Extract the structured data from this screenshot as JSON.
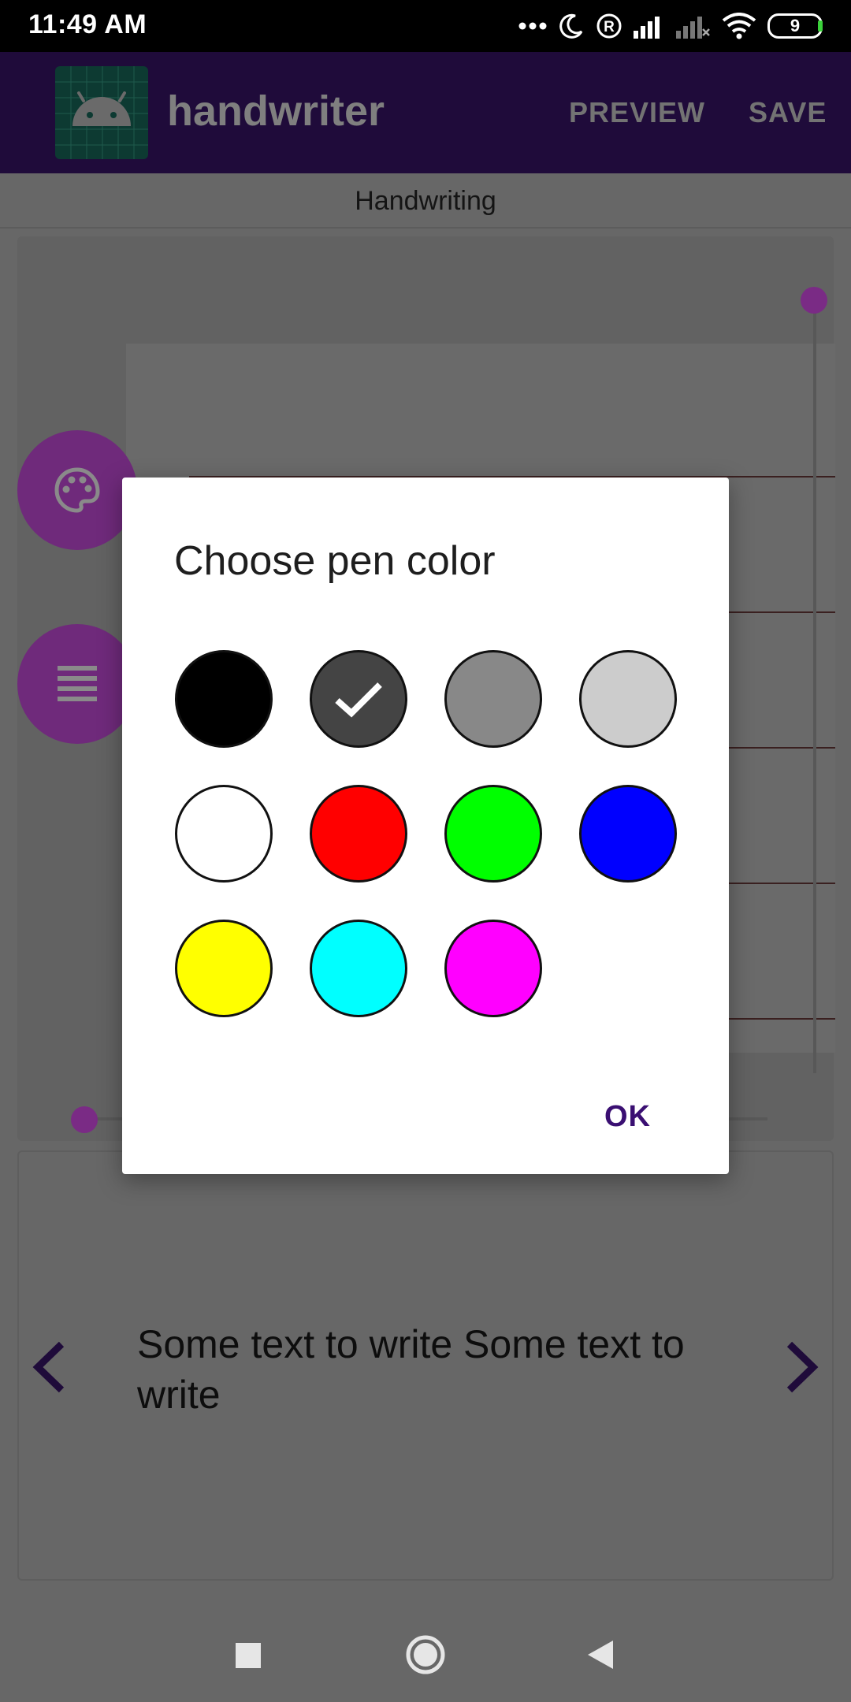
{
  "status_bar": {
    "time": "11:49 AM",
    "battery_level": "9",
    "icons": [
      "more-dots-icon",
      "moon-icon",
      "registered-icon",
      "signal-icon",
      "signal-off-icon",
      "wifi-icon",
      "battery-icon"
    ]
  },
  "app_bar": {
    "title": "handwriter",
    "preview_label": "PREVIEW",
    "save_label": "SAVE",
    "background": "#1f0b3a"
  },
  "tab": {
    "label": "Handwriting"
  },
  "canvas": {
    "fab_palette_icon": "palette-icon",
    "fab_lines_icon": "lines-icon",
    "slider_accent": "#7a2b85"
  },
  "text_panel": {
    "sample_text": "Some text to write Some text to write",
    "prev_icon": "chevron-left-icon",
    "next_icon": "chevron-right-icon"
  },
  "dialog": {
    "title": "Choose pen color",
    "ok_label": "OK",
    "selected_index": 1,
    "colors": [
      {
        "name": "black",
        "hex": "#000000"
      },
      {
        "name": "dark-gray",
        "hex": "#444444"
      },
      {
        "name": "gray",
        "hex": "#888888"
      },
      {
        "name": "light-gray",
        "hex": "#cccccc"
      },
      {
        "name": "white",
        "hex": "#ffffff"
      },
      {
        "name": "red",
        "hex": "#ff0000"
      },
      {
        "name": "green",
        "hex": "#00ff00"
      },
      {
        "name": "blue",
        "hex": "#0000ff"
      },
      {
        "name": "yellow",
        "hex": "#ffff00"
      },
      {
        "name": "cyan",
        "hex": "#00ffff"
      },
      {
        "name": "magenta",
        "hex": "#ff00ff"
      }
    ]
  },
  "nav_bar": {
    "icons": [
      "recents-icon",
      "home-icon",
      "back-icon"
    ]
  }
}
